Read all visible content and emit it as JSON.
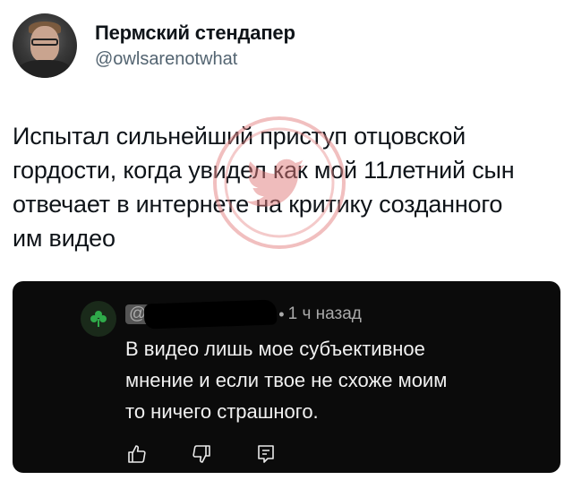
{
  "tweet": {
    "author": {
      "display_name": "Пермский стендапер",
      "handle": "@owlsarenotwhat",
      "avatar_icon": "profile-photo"
    },
    "text": "Испытал сильнейший приступ отцовской\nгордости, когда увидел как мой 11летний сын\nотвечает в интернете на критику созданного\nим видео"
  },
  "watermark": {
    "icon": "twitter-bird-icon",
    "color": "#e07a7a"
  },
  "comment": {
    "avatar_icon": "clover-icon",
    "handle_visible": "@",
    "separator": "•",
    "time": "1 ч назад",
    "text": "В видео лишь мое субъективное\nмнение и если твое не схоже моим\nто ничего страшного.",
    "actions": [
      {
        "icon": "thumbs-up-icon"
      },
      {
        "icon": "thumbs-down-icon"
      },
      {
        "icon": "reply-icon"
      }
    ]
  }
}
